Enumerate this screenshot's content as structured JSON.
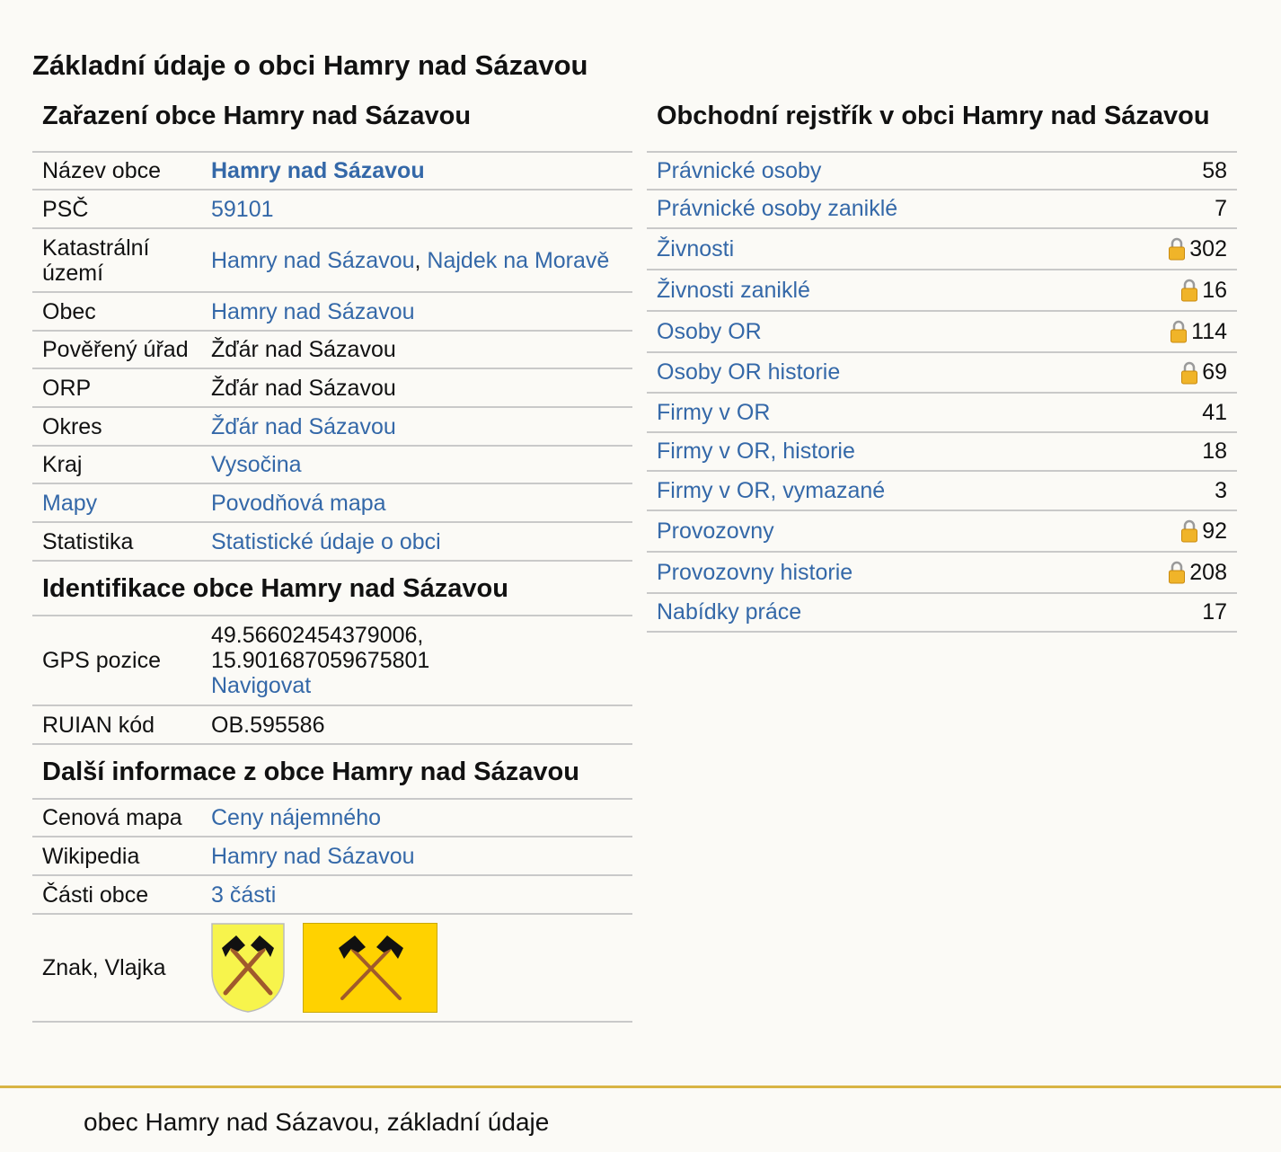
{
  "page_title": "Základní údaje o obci Hamry nad Sázavou",
  "left": {
    "zarazeni": {
      "heading": "Zařazení obce Hamry nad Sázavou",
      "rows": [
        {
          "key": "Název obce",
          "value": "Hamry nad Sázavou"
        },
        {
          "key": "PSČ",
          "value": "59101"
        },
        {
          "key": "Katastrální území",
          "value_a": "Hamry nad Sázavou",
          "sep": ", ",
          "value_b": "Najdek na Moravě"
        },
        {
          "key": "Obec",
          "value": "Hamry nad Sázavou"
        },
        {
          "key": "Pověřený úřad",
          "value": "Žďár nad Sázavou"
        },
        {
          "key": "ORP",
          "value": "Žďár nad Sázavou"
        },
        {
          "key": "Okres",
          "value": "Žďár nad Sázavou"
        },
        {
          "key": "Kraj",
          "value": "Vysočina"
        },
        {
          "key": "Mapy",
          "value": "Povodňová mapa"
        },
        {
          "key": "Statistika",
          "value": "Statistické údaje o obci"
        }
      ]
    },
    "identifikace": {
      "heading": "Identifikace obce Hamry nad Sázavou",
      "gps_key": "GPS pozice",
      "gps_lat": "49.56602454379006,",
      "gps_lon": "15.901687059675801",
      "gps_link": "Navigovat",
      "ruian_key": "RUIAN kód",
      "ruian_value": "OB.595586"
    },
    "dalsi": {
      "heading": "Další informace z obce Hamry nad Sázavou",
      "rows": [
        {
          "key": "Cenová mapa",
          "value": "Ceny nájemného"
        },
        {
          "key": "Wikipedia",
          "value": "Hamry nad Sázavou"
        },
        {
          "key": "Části obce",
          "value": "3 části"
        }
      ],
      "emblem_key": "Znak, Vlajka",
      "emblem_colors": {
        "shield": "#f7f44c",
        "flag": "#ffd200",
        "handle": "#a05a2c",
        "head": "#111111"
      }
    }
  },
  "right": {
    "heading": "Obchodní rejstřík v obci Hamry nad Sázavou",
    "rows": [
      {
        "label": "Právnické osoby",
        "count": "58",
        "locked": false
      },
      {
        "label": "Právnické osoby zaniklé",
        "count": "7",
        "locked": false
      },
      {
        "label": "Živnosti",
        "count": "302",
        "locked": true
      },
      {
        "label": "Živnosti zaniklé",
        "count": "16",
        "locked": true
      },
      {
        "label": "Osoby OR",
        "count": "114",
        "locked": true
      },
      {
        "label": "Osoby OR historie",
        "count": "69",
        "locked": true
      },
      {
        "label": "Firmy v OR",
        "count": "41",
        "locked": false
      },
      {
        "label": "Firmy v OR, historie",
        "count": "18",
        "locked": false
      },
      {
        "label": "Firmy v OR, vymazané",
        "count": "3",
        "locked": false
      },
      {
        "label": "Provozovny",
        "count": "92",
        "locked": true
      },
      {
        "label": "Provozovny historie",
        "count": "208",
        "locked": true
      },
      {
        "label": "Nabídky práce",
        "count": "17",
        "locked": false
      }
    ]
  },
  "footer": "obec Hamry nad Sázavou, základní údaje",
  "colors": {
    "link": "#3468a8",
    "gold_rule": "#d8b444",
    "lock": "#f0b429"
  }
}
